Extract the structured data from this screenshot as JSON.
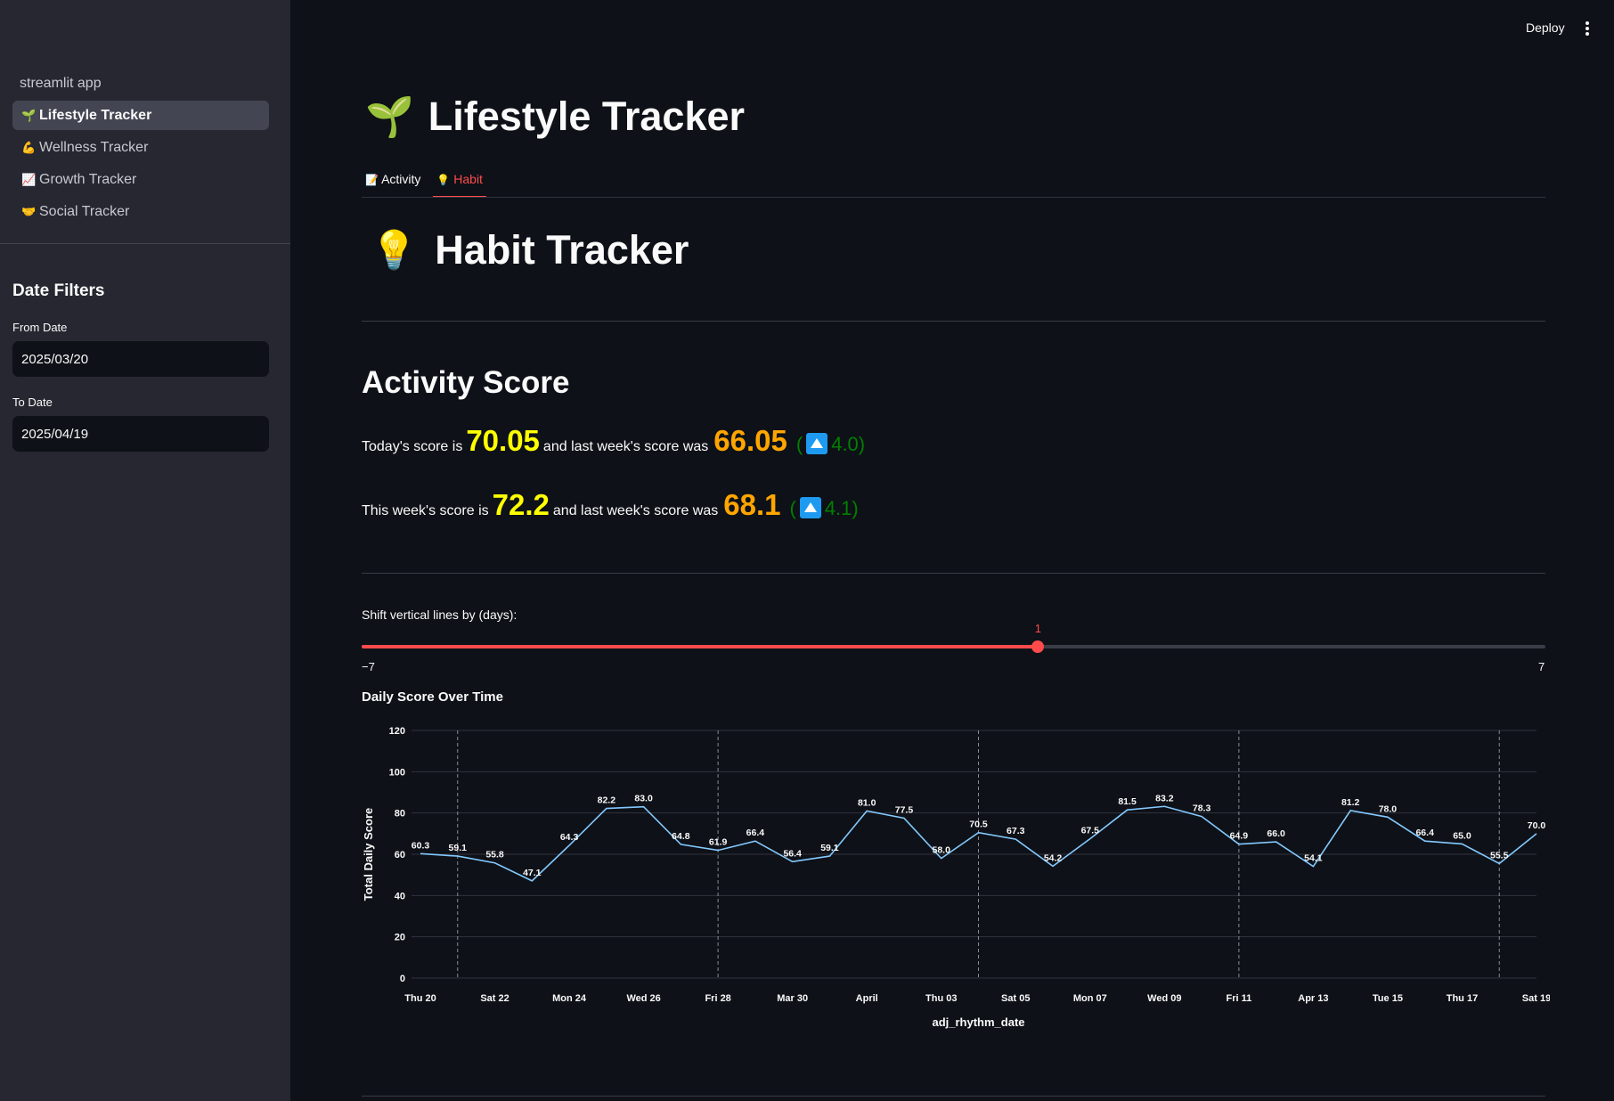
{
  "sidebar": {
    "app_label": "streamlit app",
    "nav": [
      {
        "icon": "🌱",
        "label": "Lifestyle Tracker"
      },
      {
        "icon": "💪",
        "label": "Wellness Tracker"
      },
      {
        "icon": "📈",
        "label": "Growth Tracker"
      },
      {
        "icon": "🤝",
        "label": "Social Tracker"
      }
    ],
    "filters_title": "Date Filters",
    "from_label": "From Date",
    "from_value": "2025/03/20",
    "to_label": "To Date",
    "to_value": "2025/04/19"
  },
  "header": {
    "deploy_label": "Deploy"
  },
  "page": {
    "title_icon": "🌱",
    "title": "Lifestyle Tracker",
    "tabs": [
      {
        "icon": "📝",
        "label": "Activity"
      },
      {
        "icon": "💡",
        "label": "Habit"
      }
    ],
    "active_tab": "Habit",
    "subtitle_icon": "💡",
    "subtitle": "Habit Tracker",
    "section_title": "Activity Score"
  },
  "scores": {
    "today": {
      "prefix": "Today's score is",
      "value": "70.05",
      "mid": "and last week's score was",
      "last": "66.05",
      "delta": "4.0"
    },
    "week": {
      "prefix": "This week's score is",
      "value": "72.2",
      "mid": "and last week's score was",
      "last": "68.1",
      "delta": "4.1"
    }
  },
  "slider": {
    "label": "Shift vertical lines by (days):",
    "min": -7,
    "max": 7,
    "value": 1,
    "min_label": "−7",
    "max_label": "7"
  },
  "chart_data": {
    "type": "line",
    "title": "Daily Score Over Time",
    "xlabel": "adj_rhythm_date",
    "ylabel": "Total Daily Score",
    "ylim": [
      0,
      120
    ],
    "yticks": [
      0,
      20,
      40,
      60,
      80,
      100,
      120
    ],
    "grid": true,
    "line_color": "#83c9ff",
    "x": [
      "2025-03-20",
      "2025-03-21",
      "2025-03-22",
      "2025-03-23",
      "2025-03-24",
      "2025-03-25",
      "2025-03-26",
      "2025-03-27",
      "2025-03-28",
      "2025-03-29",
      "2025-03-30",
      "2025-03-31",
      "2025-04-01",
      "2025-04-02",
      "2025-04-03",
      "2025-04-04",
      "2025-04-05",
      "2025-04-06",
      "2025-04-07",
      "2025-04-08",
      "2025-04-09",
      "2025-04-10",
      "2025-04-11",
      "2025-04-12",
      "2025-04-13",
      "2025-04-14",
      "2025-04-15",
      "2025-04-16",
      "2025-04-17",
      "2025-04-18",
      "2025-04-19"
    ],
    "values": [
      60.3,
      59.1,
      55.8,
      47.1,
      64.3,
      82.2,
      83.0,
      64.8,
      61.9,
      66.4,
      56.4,
      59.1,
      81.0,
      77.5,
      58.0,
      70.5,
      67.3,
      54.2,
      67.5,
      81.5,
      83.2,
      78.3,
      64.9,
      66.0,
      54.1,
      81.2,
      78.0,
      66.4,
      65.0,
      55.5,
      70.0
    ],
    "xtick_labels": [
      {
        "x": "2025-03-20",
        "label": "Thu 20"
      },
      {
        "x": "2025-03-22",
        "label": "Sat 22"
      },
      {
        "x": "2025-03-24",
        "label": "Mon 24"
      },
      {
        "x": "2025-03-26",
        "label": "Wed 26"
      },
      {
        "x": "2025-03-28",
        "label": "Fri 28"
      },
      {
        "x": "2025-03-30",
        "label": "Mar 30"
      },
      {
        "x": "2025-04-01",
        "label": "April"
      },
      {
        "x": "2025-04-03",
        "label": "Thu 03"
      },
      {
        "x": "2025-04-05",
        "label": "Sat 05"
      },
      {
        "x": "2025-04-07",
        "label": "Mon 07"
      },
      {
        "x": "2025-04-09",
        "label": "Wed 09"
      },
      {
        "x": "2025-04-11",
        "label": "Fri 11"
      },
      {
        "x": "2025-04-13",
        "label": "Apr 13"
      },
      {
        "x": "2025-04-15",
        "label": "Tue 15"
      },
      {
        "x": "2025-04-17",
        "label": "Thu 17"
      },
      {
        "x": "2025-04-19",
        "label": "Sat 19"
      }
    ],
    "vlines": [
      "2025-03-21",
      "2025-03-28",
      "2025-04-04",
      "2025-04-11",
      "2025-04-18"
    ]
  }
}
